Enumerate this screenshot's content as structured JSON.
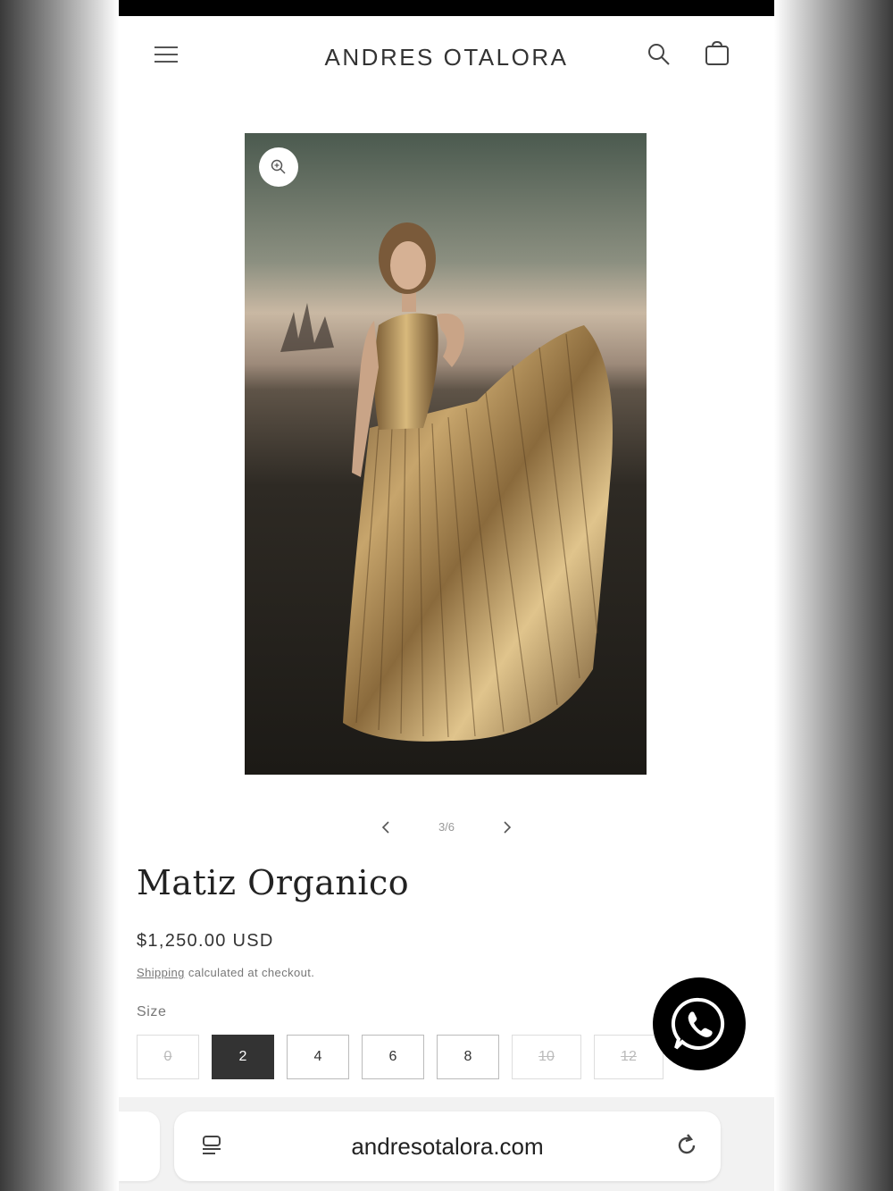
{
  "header": {
    "brand": "ANDRES OTALORA",
    "icons": [
      "menu-icon",
      "search-icon",
      "cart-icon"
    ]
  },
  "product": {
    "title": "Matiz Organico",
    "price": "$1,250.00 USD",
    "shipping_link": "Shipping",
    "shipping_rest": " calculated at checkout.",
    "size_label": "Size",
    "sizes": [
      {
        "label": "0",
        "available": false,
        "selected": false
      },
      {
        "label": "2",
        "available": true,
        "selected": true
      },
      {
        "label": "4",
        "available": true,
        "selected": false
      },
      {
        "label": "6",
        "available": true,
        "selected": false
      },
      {
        "label": "8",
        "available": true,
        "selected": false
      },
      {
        "label": "10",
        "available": false,
        "selected": false
      },
      {
        "label": "12",
        "available": false,
        "selected": false
      }
    ]
  },
  "gallery": {
    "counter": "3/6"
  },
  "browser": {
    "url": "andresotalora.com"
  },
  "colors": {
    "accent": "#333333",
    "whatsapp_bg": "#000000",
    "dress_gold": "#b8955e"
  }
}
